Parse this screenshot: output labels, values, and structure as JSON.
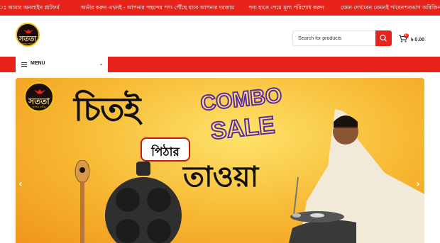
{
  "announcements": [
    "ঃ আমার অনলাইন প্লাটফর্ম",
    "অর্ডার করুন এখনই - আপনার পছন্দের পণ্য পৌঁছে যাবে আপনার দরজায়",
    "পন্য হাতে পেয়ে মূল্য পরিশোধ করুন",
    "যেমন দেখাবেন তেমনই পাবেন",
    "শতভাগ অরিজিনাল"
  ],
  "brand": {
    "logo_text": "সততা",
    "logo_sub": "আস্থার প্রতীক"
  },
  "search": {
    "placeholder": "Search for products"
  },
  "cart": {
    "count": "0",
    "total": "৳ 0.00"
  },
  "nav": {
    "menu_label": "MENU"
  },
  "hero": {
    "title_line1": "চিতই",
    "pill_text": "পিঠার",
    "title_line2": "তাওয়া",
    "badge_word1": "COMBO",
    "badge_word2": "SALE"
  },
  "colors": {
    "brand_red": "#e8231b",
    "hero_yellow": "#f7b731",
    "combo_purple": "#5a2aa8"
  },
  "icons": [
    "search-icon",
    "cart-icon",
    "hamburger-icon",
    "chevron-down-icon",
    "arrow-left-icon",
    "arrow-right-icon"
  ]
}
